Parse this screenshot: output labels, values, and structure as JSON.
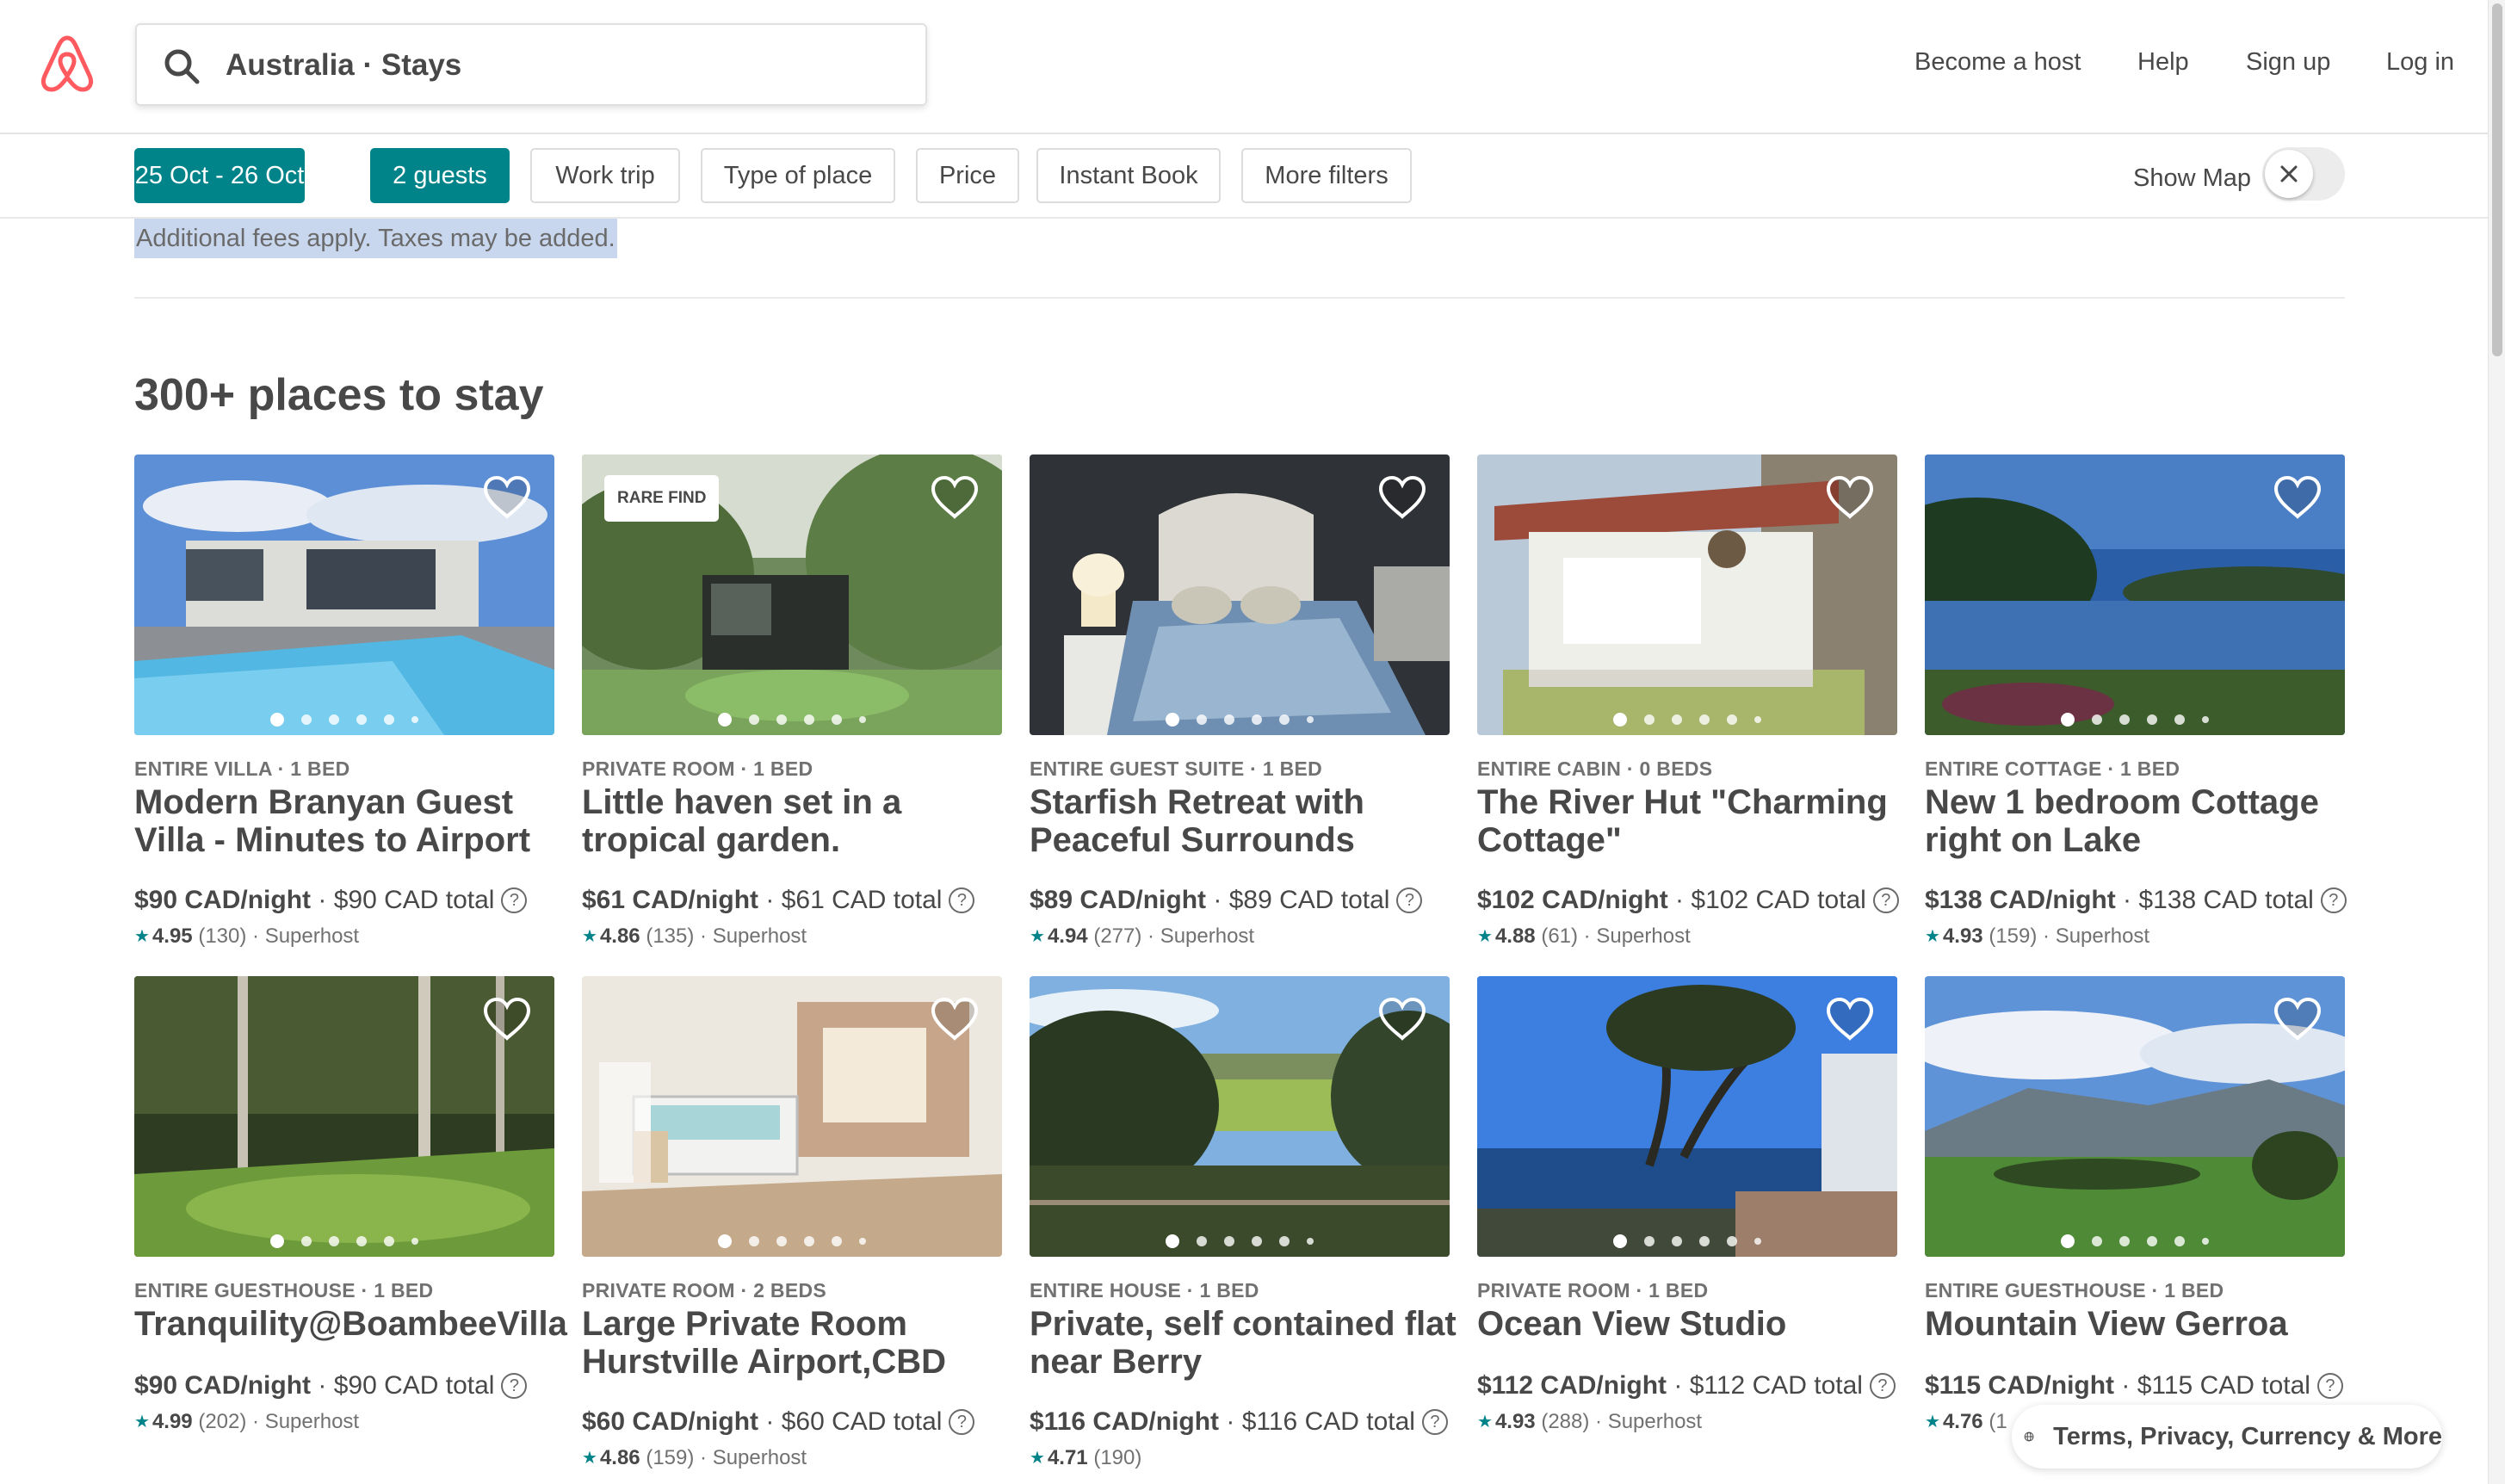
{
  "header": {
    "logo_icon": "airbnb-logo-icon",
    "search_text": "Australia · Stays",
    "nav": [
      "Become a host",
      "Help",
      "Sign up",
      "Log in"
    ]
  },
  "filters": {
    "chips": [
      "25 Oct - 26 Oct",
      "2 guests",
      "Work trip",
      "Type of place",
      "Price",
      "Instant Book",
      "More filters"
    ],
    "show_map_label": "Show Map"
  },
  "notice": "Additional fees apply. Taxes may be added.",
  "section_title": "300+ places to stay",
  "listings": [
    {
      "kind": "ENTIRE VILLA · 1 BED",
      "title": "Modern Branyan Guest Villa - Minutes to Airport",
      "price": "$90 CAD/night",
      "total": "$90 CAD total",
      "rating": "4.95",
      "reviews": "(130)",
      "host": "Superhost",
      "badge": ""
    },
    {
      "kind": "PRIVATE ROOM · 1 BED",
      "title": "Little haven set in a tropical garden.",
      "price": "$61 CAD/night",
      "total": "$61 CAD total",
      "rating": "4.86",
      "reviews": "(135)",
      "host": "Superhost",
      "badge": "RARE FIND"
    },
    {
      "kind": "ENTIRE GUEST SUITE · 1 BED",
      "title": "Starfish Retreat with Peaceful Surrounds",
      "price": "$89 CAD/night",
      "total": "$89 CAD total",
      "rating": "4.94",
      "reviews": "(277)",
      "host": "Superhost",
      "badge": ""
    },
    {
      "kind": "ENTIRE CABIN · 0 BEDS",
      "title": "The River Hut \"Charming Cottage\"",
      "price": "$102 CAD/night",
      "total": "$102 CAD total",
      "rating": "4.88",
      "reviews": "(61)",
      "host": "Superhost",
      "badge": ""
    },
    {
      "kind": "ENTIRE COTTAGE · 1 BED",
      "title": "New 1 bedroom Cottage right on Lake",
      "price": "$138 CAD/night",
      "total": "$138 CAD total",
      "rating": "4.93",
      "reviews": "(159)",
      "host": "Superhost",
      "badge": ""
    },
    {
      "kind": "ENTIRE GUESTHOUSE · 1 BED",
      "title": "Tranquility@BoambeeVilla",
      "price": "$90 CAD/night",
      "total": "$90 CAD total",
      "rating": "4.99",
      "reviews": "(202)",
      "host": "Superhost",
      "badge": ""
    },
    {
      "kind": "PRIVATE ROOM · 2 BEDS",
      "title": "Large Private Room Hurstville Airport,CBD",
      "price": "$60 CAD/night",
      "total": "$60 CAD total",
      "rating": "4.86",
      "reviews": "(159)",
      "host": "Superhost",
      "badge": ""
    },
    {
      "kind": "ENTIRE HOUSE · 1 BED",
      "title": "Private, self contained flat near Berry",
      "price": "$116 CAD/night",
      "total": "$116 CAD total",
      "rating": "4.71",
      "reviews": "(190)",
      "host": "",
      "badge": ""
    },
    {
      "kind": "PRIVATE ROOM · 1 BED",
      "title": "Ocean View Studio",
      "price": "$112 CAD/night",
      "total": "$112 CAD total",
      "rating": "4.93",
      "reviews": "(288)",
      "host": "Superhost",
      "badge": ""
    },
    {
      "kind": "ENTIRE GUESTHOUSE · 1 BED",
      "title": "Mountain View Gerroa",
      "price": "$115 CAD/night",
      "total": "$115 CAD total",
      "rating": "4.76",
      "reviews": "(1",
      "host": "",
      "badge": ""
    }
  ],
  "footer_link": "Terms, Privacy, Currency & More",
  "colors": {
    "accent": "#008489",
    "brand": "#FF5A5F",
    "text": "#484848",
    "highlight": "#c9d7ee"
  }
}
